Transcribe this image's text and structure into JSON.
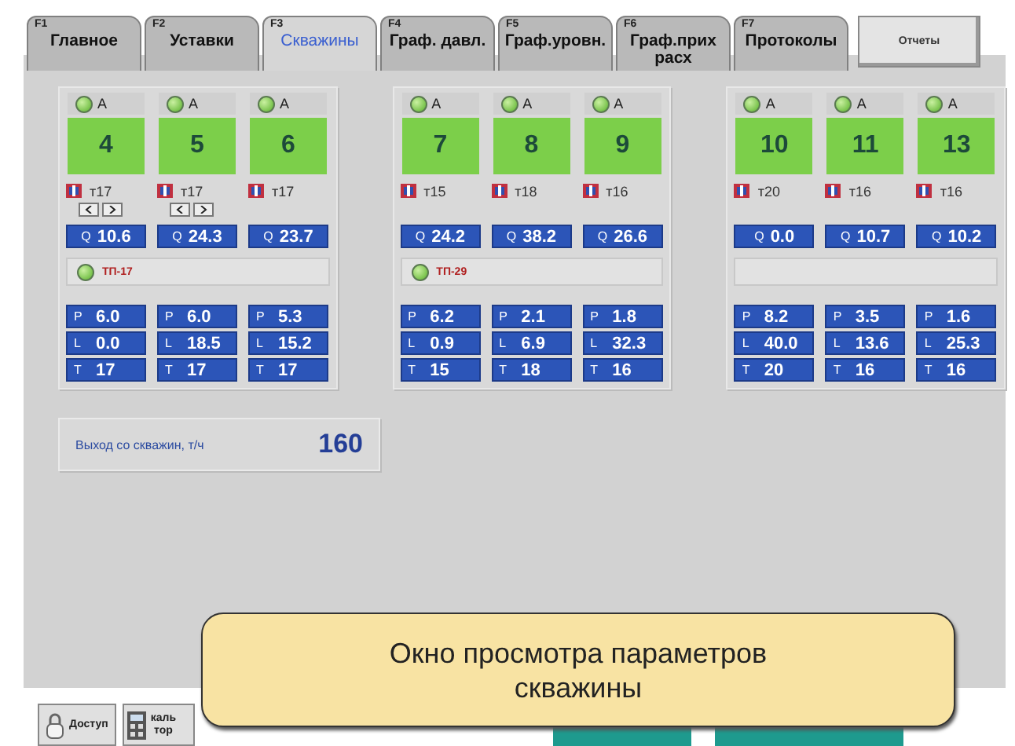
{
  "tabs": [
    {
      "key": "F1",
      "label": "Главное",
      "selected": false,
      "kind": "tab"
    },
    {
      "key": "F2",
      "label": "Уставки",
      "selected": false,
      "kind": "tab"
    },
    {
      "key": "F3",
      "label": "Скважины",
      "selected": true,
      "kind": "tab"
    },
    {
      "key": "F4",
      "label": "Граф. давл.",
      "selected": false,
      "kind": "tab"
    },
    {
      "key": "F5",
      "label": "Граф.уровн.",
      "selected": false,
      "kind": "tab"
    },
    {
      "key": "F6",
      "label": "Граф.прих расх",
      "selected": false,
      "kind": "tab"
    },
    {
      "key": "F7",
      "label": "Протоколы",
      "selected": false,
      "kind": "tab"
    },
    {
      "label": "Отчеты",
      "selected": false,
      "kind": "button"
    }
  ],
  "groups": [
    {
      "wells": [
        {
          "status": "A",
          "running": true,
          "number": "4",
          "temp": "т17",
          "arrows": true,
          "q": {
            "label": "Q",
            "value": "10.6"
          },
          "params": [
            {
              "label": "P",
              "value": "6.0"
            },
            {
              "label": "L",
              "value": "0.0"
            },
            {
              "label": "T",
              "value": "17"
            }
          ]
        },
        {
          "status": "A",
          "running": true,
          "number": "5",
          "temp": "т17",
          "arrows": true,
          "q": {
            "label": "Q",
            "value": "24.3"
          },
          "params": [
            {
              "label": "P",
              "value": "6.0"
            },
            {
              "label": "L",
              "value": "18.5"
            },
            {
              "label": "T",
              "value": "17"
            }
          ]
        },
        {
          "status": "A",
          "running": true,
          "number": "6",
          "temp": "т17",
          "arrows": false,
          "q": {
            "label": "Q",
            "value": "23.7"
          },
          "params": [
            {
              "label": "P",
              "value": "5.3"
            },
            {
              "label": "L",
              "value": "15.2"
            },
            {
              "label": "T",
              "value": "17"
            }
          ]
        }
      ],
      "substation": {
        "label": "ТП-17",
        "on": true
      }
    },
    {
      "wells": [
        {
          "status": "A",
          "running": true,
          "number": "7",
          "temp": "т15",
          "arrows": false,
          "q": {
            "label": "Q",
            "value": "24.2"
          },
          "params": [
            {
              "label": "P",
              "value": "6.2"
            },
            {
              "label": "L",
              "value": "0.9"
            },
            {
              "label": "T",
              "value": "15"
            }
          ]
        },
        {
          "status": "A",
          "running": true,
          "number": "8",
          "temp": "т18",
          "arrows": false,
          "q": {
            "label": "Q",
            "value": "38.2"
          },
          "params": [
            {
              "label": "P",
              "value": "2.1"
            },
            {
              "label": "L",
              "value": "6.9"
            },
            {
              "label": "T",
              "value": "18"
            }
          ]
        },
        {
          "status": "A",
          "running": true,
          "number": "9",
          "temp": "т16",
          "arrows": false,
          "q": {
            "label": "Q",
            "value": "26.6"
          },
          "params": [
            {
              "label": "P",
              "value": "1.8"
            },
            {
              "label": "L",
              "value": "32.3"
            },
            {
              "label": "T",
              "value": "16"
            }
          ]
        }
      ],
      "substation": {
        "label": "ТП-29",
        "on": true
      }
    },
    {
      "wells": [
        {
          "status": "A",
          "running": true,
          "number": "10",
          "temp": "т20",
          "arrows": false,
          "q": {
            "label": "Q",
            "value": "0.0"
          },
          "params": [
            {
              "label": "P",
              "value": "8.2"
            },
            {
              "label": "L",
              "value": "40.0"
            },
            {
              "label": "T",
              "value": "20"
            }
          ]
        },
        {
          "status": "A",
          "running": true,
          "number": "11",
          "temp": "т16",
          "arrows": false,
          "q": {
            "label": "Q",
            "value": "10.7"
          },
          "params": [
            {
              "label": "P",
              "value": "3.5"
            },
            {
              "label": "L",
              "value": "13.6"
            },
            {
              "label": "T",
              "value": "16"
            }
          ]
        },
        {
          "status": "A",
          "running": true,
          "number": "13",
          "temp": "т16",
          "arrows": false,
          "q": {
            "label": "Q",
            "value": "10.2"
          },
          "params": [
            {
              "label": "P",
              "value": "1.6"
            },
            {
              "label": "L",
              "value": "25.3"
            },
            {
              "label": "T",
              "value": "16"
            }
          ]
        }
      ]
    }
  ],
  "output": {
    "label": "Выход со скважин, т/ч",
    "value": "160"
  },
  "bottom_bar": {
    "buttons": [
      {
        "kind": "lock",
        "label": "Доступ"
      },
      {
        "kind": "calculator",
        "lines": [
          "каль",
          "тор"
        ]
      }
    ]
  },
  "callout": {
    "text": "Окно просмотра параметров скважины"
  }
}
